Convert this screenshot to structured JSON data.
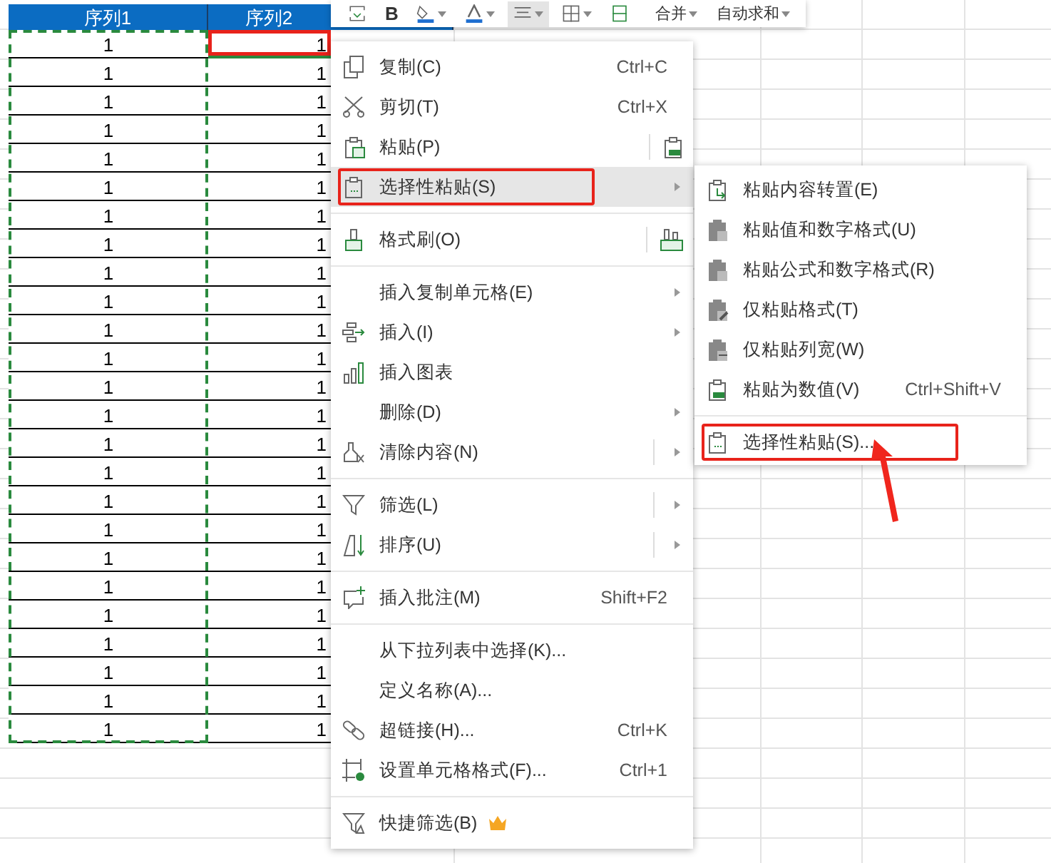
{
  "toolbar": {
    "items": [
      {
        "kind": "icon",
        "selected": false
      },
      {
        "kind": "text",
        "label": "B",
        "selected": false
      },
      {
        "kind": "icon",
        "selected": false
      },
      {
        "kind": "icon",
        "selected": false
      },
      {
        "kind": "icon",
        "selected": true
      },
      {
        "kind": "icon",
        "selected": false
      },
      {
        "kind": "icon",
        "selected": false
      },
      {
        "kind": "dropdown",
        "label": "合并",
        "selected": false
      },
      {
        "kind": "dropdown",
        "label": "自动求和",
        "selected": false
      }
    ]
  },
  "table": {
    "columns": [
      {
        "label": "序列1",
        "marked": true
      },
      {
        "label": "序列2",
        "marked": false
      }
    ],
    "rows": [
      [
        {
          "text": "1",
          "selected": false,
          "outlined": false
        },
        {
          "text": "1",
          "selected": true,
          "outlined": true
        }
      ],
      [
        {
          "text": "1",
          "selected": false,
          "outlined": false
        },
        {
          "text": "1",
          "selected": false,
          "outlined": false
        }
      ],
      [
        {
          "text": "1",
          "selected": false,
          "outlined": false
        },
        {
          "text": "1",
          "selected": false,
          "outlined": false
        }
      ],
      [
        {
          "text": "1",
          "selected": false,
          "outlined": false
        },
        {
          "text": "1",
          "selected": false,
          "outlined": false
        }
      ],
      [
        {
          "text": "1",
          "selected": false,
          "outlined": false
        },
        {
          "text": "1",
          "selected": false,
          "outlined": false
        }
      ],
      [
        {
          "text": "1",
          "selected": false,
          "outlined": false
        },
        {
          "text": "1",
          "selected": false,
          "outlined": false
        }
      ],
      [
        {
          "text": "1",
          "selected": false,
          "outlined": false
        },
        {
          "text": "1",
          "selected": false,
          "outlined": false
        }
      ],
      [
        {
          "text": "1",
          "selected": false,
          "outlined": false
        },
        {
          "text": "1",
          "selected": false,
          "outlined": false
        }
      ],
      [
        {
          "text": "1",
          "selected": false,
          "outlined": false
        },
        {
          "text": "1",
          "selected": false,
          "outlined": false
        }
      ],
      [
        {
          "text": "1",
          "selected": false,
          "outlined": false
        },
        {
          "text": "1",
          "selected": false,
          "outlined": false
        }
      ],
      [
        {
          "text": "1",
          "selected": false,
          "outlined": false
        },
        {
          "text": "1",
          "selected": false,
          "outlined": false
        }
      ],
      [
        {
          "text": "1",
          "selected": false,
          "outlined": false
        },
        {
          "text": "1",
          "selected": false,
          "outlined": false
        }
      ],
      [
        {
          "text": "1",
          "selected": false,
          "outlined": false
        },
        {
          "text": "1",
          "selected": false,
          "outlined": false
        }
      ],
      [
        {
          "text": "1",
          "selected": false,
          "outlined": false
        },
        {
          "text": "1",
          "selected": false,
          "outlined": false
        }
      ],
      [
        {
          "text": "1",
          "selected": false,
          "outlined": false
        },
        {
          "text": "1",
          "selected": false,
          "outlined": false
        }
      ],
      [
        {
          "text": "1",
          "selected": false,
          "outlined": false
        },
        {
          "text": "1",
          "selected": false,
          "outlined": false
        }
      ],
      [
        {
          "text": "1",
          "selected": false,
          "outlined": false
        },
        {
          "text": "1",
          "selected": false,
          "outlined": false
        }
      ],
      [
        {
          "text": "1",
          "selected": false,
          "outlined": false
        },
        {
          "text": "1",
          "selected": false,
          "outlined": false
        }
      ],
      [
        {
          "text": "1",
          "selected": false,
          "outlined": false
        },
        {
          "text": "1",
          "selected": false,
          "outlined": false
        }
      ],
      [
        {
          "text": "1",
          "selected": false,
          "outlined": false
        },
        {
          "text": "1",
          "selected": false,
          "outlined": false
        }
      ],
      [
        {
          "text": "1",
          "selected": false,
          "outlined": false
        },
        {
          "text": "1",
          "selected": false,
          "outlined": false
        }
      ],
      [
        {
          "text": "1",
          "selected": false,
          "outlined": false
        },
        {
          "text": "1",
          "selected": false,
          "outlined": false
        }
      ],
      [
        {
          "text": "1",
          "selected": false,
          "outlined": false
        },
        {
          "text": "1",
          "selected": false,
          "outlined": false
        }
      ],
      [
        {
          "text": "1",
          "selected": false,
          "outlined": false
        },
        {
          "text": "1",
          "selected": false,
          "outlined": false
        }
      ],
      [
        {
          "text": "1",
          "selected": false,
          "outlined": false
        },
        {
          "text": "1",
          "selected": false,
          "outlined": false
        }
      ]
    ]
  },
  "context_menu": {
    "items": [
      {
        "kind": "command",
        "label": "复制(C)",
        "shortcut": "Ctrl+C",
        "selected": false,
        "outlined": false
      },
      {
        "kind": "command",
        "label": "剪切(T)",
        "shortcut": "Ctrl+X",
        "selected": false,
        "outlined": false
      },
      {
        "kind": "split_button",
        "label": "粘贴(P)",
        "selected": false,
        "outlined": false
      },
      {
        "kind": "submenu",
        "label": "选择性粘贴(S)",
        "split": false,
        "selected": true,
        "outlined": true
      },
      {
        "kind": "separator"
      },
      {
        "kind": "split_button",
        "label": "格式刷(O)",
        "selected": false,
        "outlined": false
      },
      {
        "kind": "separator"
      },
      {
        "kind": "submenu",
        "label": "插入复制单元格(E)",
        "split": false,
        "selected": false,
        "outlined": false
      },
      {
        "kind": "submenu",
        "label": "插入(I)",
        "split": false,
        "selected": false,
        "outlined": false
      },
      {
        "kind": "command",
        "label": "插入图表",
        "selected": false,
        "outlined": false
      },
      {
        "kind": "submenu",
        "label": "删除(D)",
        "split": false,
        "selected": false,
        "outlined": false
      },
      {
        "kind": "submenu",
        "label": "清除内容(N)",
        "split": true,
        "selected": false,
        "outlined": false
      },
      {
        "kind": "separator"
      },
      {
        "kind": "submenu",
        "label": "筛选(L)",
        "split": true,
        "selected": false,
        "outlined": false
      },
      {
        "kind": "submenu",
        "label": "排序(U)",
        "split": true,
        "selected": false,
        "outlined": false
      },
      {
        "kind": "separator"
      },
      {
        "kind": "command",
        "label": "插入批注(M)",
        "shortcut": "Shift+F2",
        "selected": false,
        "outlined": false
      },
      {
        "kind": "separator"
      },
      {
        "kind": "command",
        "label": "从下拉列表中选择(K)...",
        "selected": false,
        "outlined": false
      },
      {
        "kind": "command",
        "label": "定义名称(A)...",
        "selected": false,
        "outlined": false
      },
      {
        "kind": "command",
        "label": "超链接(H)...",
        "shortcut": "Ctrl+K",
        "selected": false,
        "outlined": false
      },
      {
        "kind": "command",
        "label": "设置单元格格式(F)...",
        "shortcut": "Ctrl+1",
        "selected": false,
        "outlined": false
      },
      {
        "kind": "separator"
      },
      {
        "kind": "command",
        "label": "快捷筛选(B)",
        "selected": false,
        "outlined": false
      }
    ]
  },
  "submenu": {
    "items": [
      {
        "kind": "command",
        "label": "粘贴内容转置(E)",
        "selected": false,
        "outlined": false
      },
      {
        "kind": "command",
        "label": "粘贴值和数字格式(U)",
        "selected": false,
        "outlined": false
      },
      {
        "kind": "command",
        "label": "粘贴公式和数字格式(R)",
        "selected": false,
        "outlined": false
      },
      {
        "kind": "command",
        "label": "仅粘贴格式(T)",
        "selected": false,
        "outlined": false
      },
      {
        "kind": "command",
        "label": "仅粘贴列宽(W)",
        "selected": false,
        "outlined": false
      },
      {
        "kind": "command",
        "label": "粘贴为数值(V)",
        "shortcut": "Ctrl+Shift+V",
        "selected": false,
        "outlined": false
      },
      {
        "kind": "separator"
      },
      {
        "kind": "command",
        "label": "选择性粘贴(S)...",
        "selected": false,
        "outlined": true
      }
    ]
  }
}
